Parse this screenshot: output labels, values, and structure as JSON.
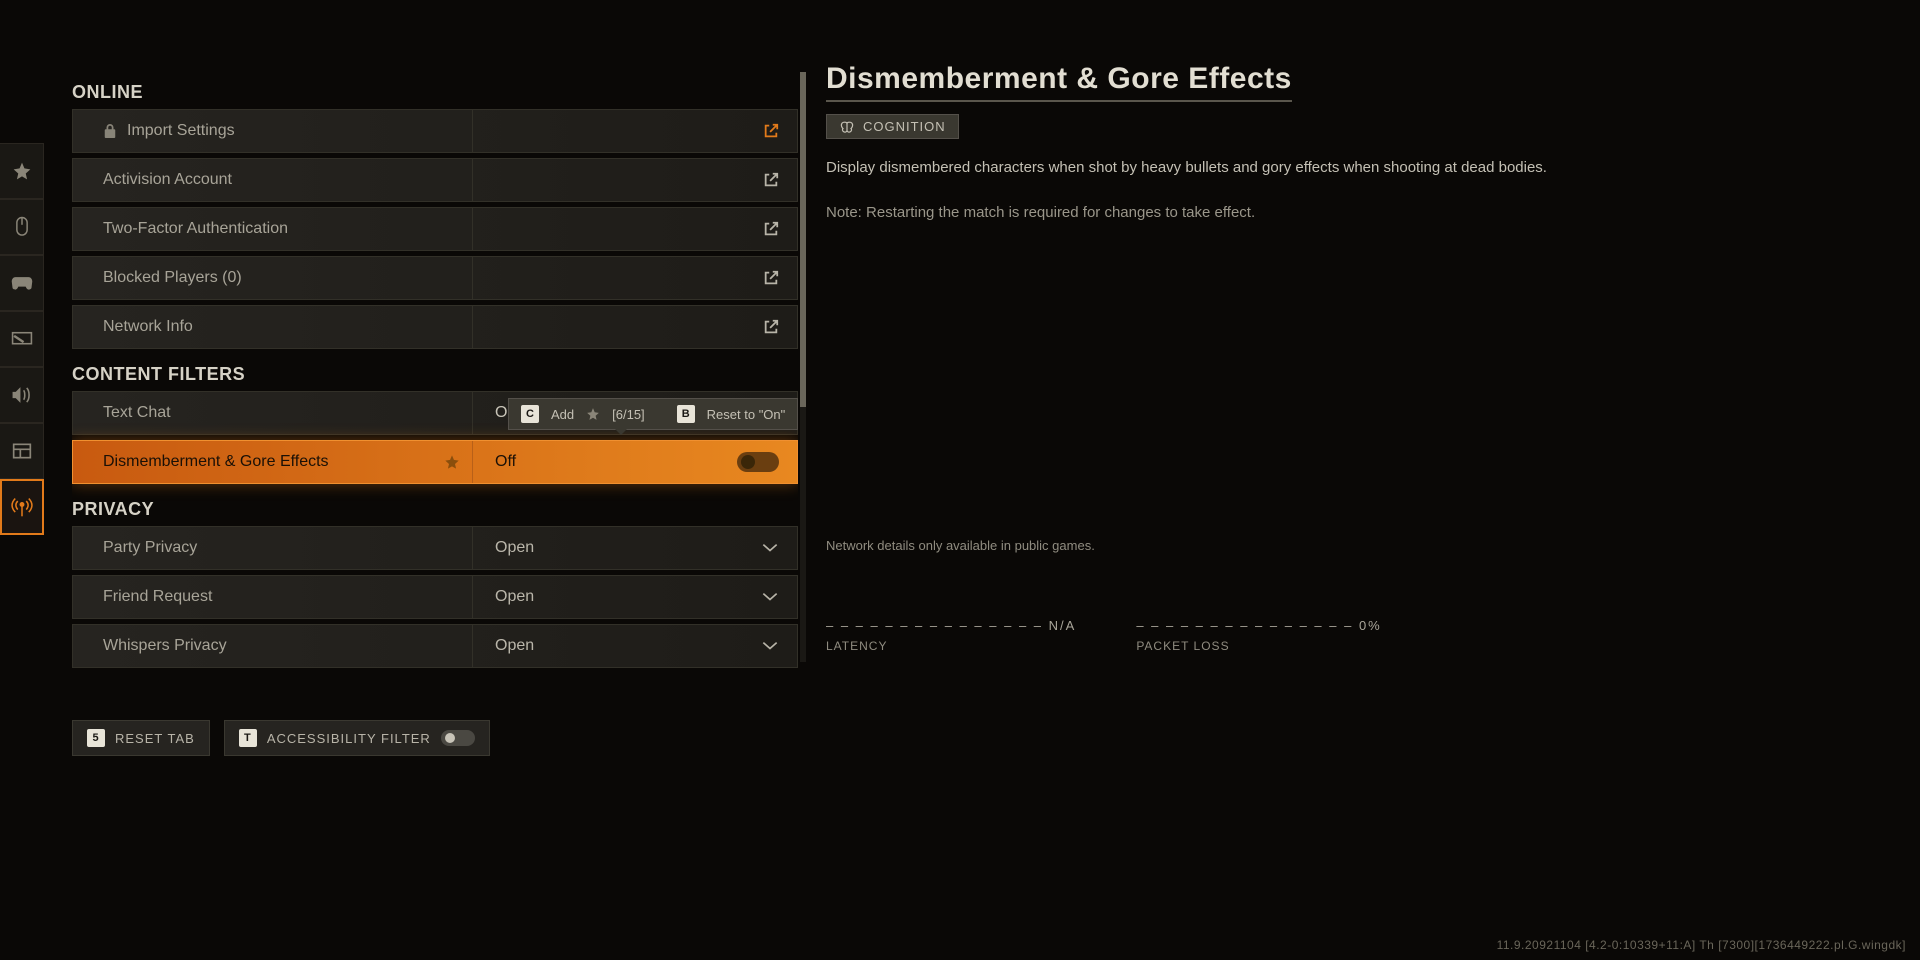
{
  "sidebar": {
    "tabs": [
      "star",
      "mouse",
      "controller",
      "monitor",
      "audio",
      "interface",
      "network"
    ],
    "active_index": 6
  },
  "sections": {
    "online": {
      "header": "ONLINE",
      "items": [
        {
          "label": "Import Settings",
          "icon": "lock",
          "external": true,
          "external_color": "orange"
        },
        {
          "label": "Activision Account",
          "external": true
        },
        {
          "label": "Two-Factor Authentication",
          "external": true
        },
        {
          "label": "Blocked Players (0)",
          "external": true
        },
        {
          "label": "Network Info",
          "external": true
        }
      ]
    },
    "content_filters": {
      "header": "CONTENT FILTERS",
      "items": [
        {
          "label": "Text Chat",
          "value": "On",
          "type": "radio"
        },
        {
          "label": "Dismemberment & Gore Effects",
          "value": "Off",
          "type": "toggle",
          "selected": true,
          "starred": true
        }
      ]
    },
    "privacy": {
      "header": "PRIVACY",
      "items": [
        {
          "label": "Party Privacy",
          "value": "Open",
          "type": "dropdown"
        },
        {
          "label": "Friend Request",
          "value": "Open",
          "type": "dropdown"
        },
        {
          "label": "Whispers Privacy",
          "value": "Open",
          "type": "dropdown"
        }
      ]
    }
  },
  "tooltip": {
    "key1": "C",
    "action1": "Add",
    "counter": "[6/15]",
    "key2": "B",
    "action2": "Reset to \"On\""
  },
  "detail": {
    "title": "Dismemberment & Gore Effects",
    "tag": "COGNITION",
    "description": "Display dismembered characters when shot by heavy bullets and gory effects when shooting at dead bodies.",
    "note": "Note: Restarting the match is required for changes to take effect.",
    "network_note": "Network details only available in public games."
  },
  "stats": {
    "latency": {
      "value": "– – – – – – – – – – – – – – –   N/A",
      "label": "LATENCY"
    },
    "packet_loss": {
      "value": "– – – – – – – – – – – – – – –   0%",
      "label": "PACKET LOSS"
    }
  },
  "bottom": {
    "reset_key": "5",
    "reset_label": "RESET TAB",
    "filter_key": "T",
    "filter_label": "ACCESSIBILITY FILTER"
  },
  "version": "11.9.20921104 [4.2-0:10339+11:A] Th [7300][1736449222.pl.G.wingdk]"
}
